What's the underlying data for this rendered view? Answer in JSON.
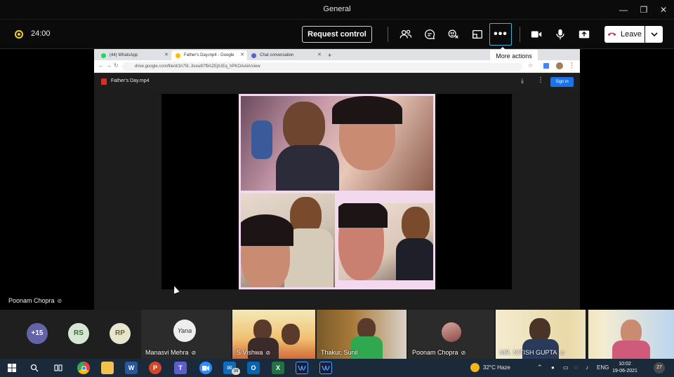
{
  "window": {
    "title": "General",
    "minimize_icon": "minimize-icon",
    "maximize_icon": "restore-icon",
    "close_icon": "close-icon"
  },
  "controls": {
    "timer": "24:00",
    "request_control": "Request control",
    "more_actions_tooltip": "More actions",
    "leave_label": "Leave",
    "icons": [
      "participants-icon",
      "chat-icon",
      "reactions-icon",
      "rooms-icon",
      "more-icon",
      "camera-icon",
      "microphone-icon",
      "share-icon",
      "phone-icon"
    ]
  },
  "browser": {
    "tabs": [
      {
        "label": "(44) WhatsApp",
        "favicon_color": "#25d366"
      },
      {
        "label": "Father's Day.mp4 - Google",
        "favicon_color": "#fbbc04"
      },
      {
        "label": "Chat conversation",
        "favicon_color": "#5b5fc7"
      }
    ],
    "new_tab": "+",
    "url": "drive.google.com/file/d/1h75t..3ssw87f9AZEjtUEq_hPKOAvIiA/view",
    "file_name": "Father's Day.mp4",
    "sign_in": "Sign in"
  },
  "stage": {
    "presenter_name": "Poonam Chopra"
  },
  "gallery": {
    "overflow_count": "+15",
    "initials": [
      {
        "text": "RS",
        "bg": "#d6e8d4",
        "fg": "#3a6b35"
      },
      {
        "text": "RP",
        "bg": "#e8e5cf",
        "fg": "#6b6535"
      }
    ],
    "named_tiles": [
      {
        "name": "Manasvi Mehra"
      },
      {
        "name": "S Vishwa"
      },
      {
        "name": "Thakur, Sunil"
      },
      {
        "name": "Poonam Chopra"
      },
      {
        "name": "MR. NITISH GUPTA"
      },
      {
        "name": ""
      }
    ],
    "logo_text": "Yana"
  },
  "taskbar": {
    "apps": [
      "windows-icon",
      "search-icon",
      "task-view-icon",
      "chrome-icon",
      "explorer-icon",
      "word-icon",
      "powerpoint-icon",
      "teams-icon",
      "zoom-icon",
      "mail-icon",
      "outlook-icon",
      "excel-icon",
      "webex-icon",
      "webex-meetings-icon"
    ],
    "weather": "32°C  Haze",
    "language": "ENG",
    "time": "10:02",
    "date": "19-06-2021",
    "notification_count": "27",
    "mail_badge": "39"
  },
  "colors": {
    "accent": "#3fb4d8",
    "recording": "#f2d11a",
    "collage_border": "#f3d9ee",
    "sign_in": "#1a73e8"
  }
}
